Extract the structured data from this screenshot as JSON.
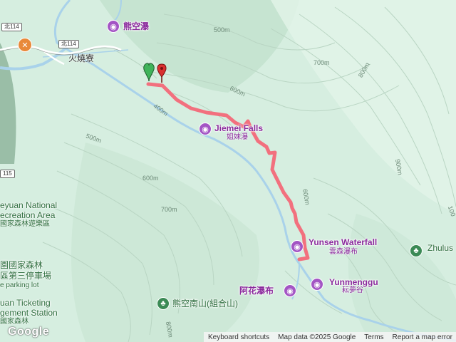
{
  "map": {
    "colors": {
      "terrain": "#d6eee0",
      "river": "#a9d2ea",
      "track": "#f2707e",
      "poi": "#a355c4",
      "park": "#3b8a55"
    },
    "road_shields": [
      "北114",
      "北114",
      "115"
    ],
    "places": [
      {
        "name": "火燒寮"
      }
    ],
    "pois": [
      {
        "name": "熊空瀑",
        "icon": "camera-icon"
      },
      {
        "name": "Jiemei Falls",
        "sub": "姐妹瀑",
        "icon": "camera-icon"
      },
      {
        "name": "Yunsen Waterfall",
        "sub": "雲森瀑布",
        "icon": "camera-icon"
      },
      {
        "name": "Yunmenggu",
        "sub": "耘夢谷",
        "icon": "camera-icon"
      },
      {
        "name": "阿花瀑布",
        "icon": "camera-icon"
      }
    ],
    "parks": [
      {
        "name": "熊空南山(組合山)",
        "icon": "tree-icon"
      },
      {
        "name": "Zhulus",
        "icon": "tree-icon"
      },
      {
        "name": "eyuan National",
        "sub": "ecreation Area",
        "sub2": "國家森林遊樂區"
      },
      {
        "name": "園國家森林",
        "sub": "區第三停車場",
        "sub2": "e parking lot"
      },
      {
        "name": "uan Ticketing",
        "sub": "gement Station",
        "sub2": "國家森林"
      }
    ],
    "elevations": [
      "500m",
      "700m",
      "800m",
      "600m",
      "400m",
      "500m",
      "600m",
      "700m",
      "600m",
      "900m",
      "100",
      "800m"
    ],
    "markers": {
      "start": "start-flag-icon",
      "end": "end-pin-icon"
    }
  },
  "footer": {
    "logo": "Google",
    "links": [
      "Keyboard shortcuts",
      "Map data ©2025 Google",
      "Terms",
      "Report a map error"
    ]
  }
}
